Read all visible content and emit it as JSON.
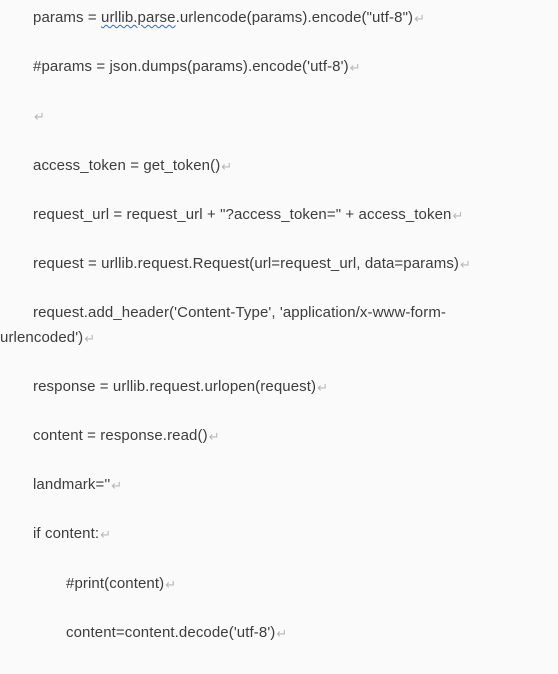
{
  "code": {
    "l1": "params = ",
    "l1b": "urllib.parse",
    "l1c": ".urlencode(params).encode(\"utf-8\")",
    "l2": "#params = json.dumps(params).encode('utf-8')",
    "l3": "",
    "l4": "access_token = get_token()",
    "l5": "request_url = request_url + \"?access_token=\" + access_token",
    "l6": "request = urllib.request.Request(url=request_url, data=params)",
    "l7": "request.add_header('Content-Type', 'application/x-www-form-",
    "l7b": "urlencoded')",
    "l8": "response = urllib.request.urlopen(request)",
    "l9": "content = response.read()",
    "l10": "landmark=''",
    "l11": "if content:",
    "l12": "#print(content)",
    "l13": "content=content.decode('utf-8')"
  },
  "eol": "↵"
}
